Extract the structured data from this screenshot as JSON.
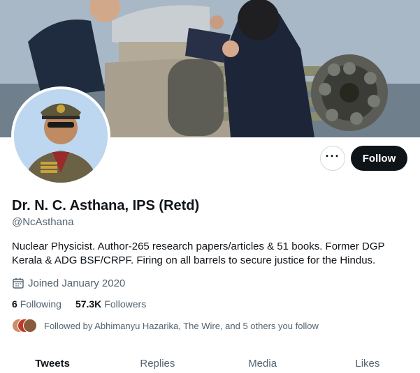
{
  "profile": {
    "name": "Dr. N. C. Asthana, IPS (Retd)",
    "handle": "@NcAsthana",
    "bio": "Nuclear Physicist. Author-265 research papers/articles & 51 books. Former DGP Kerala & ADG BSF/CRPF. Firing on all barrels to secure justice for the Hindus.",
    "joined": "Joined January 2020",
    "following_count": "6",
    "following_label": "Following",
    "followers_count": "57.3K",
    "followers_label": "Followers",
    "followed_by": "Followed by Abhimanyu Hazarika, The Wire, and 5 others you follow"
  },
  "actions": {
    "more_label": "···",
    "follow_label": "Follow"
  },
  "tabs": [
    {
      "label": "Tweets",
      "active": true
    },
    {
      "label": "Replies",
      "active": false
    },
    {
      "label": "Media",
      "active": false
    },
    {
      "label": "Likes",
      "active": false
    }
  ],
  "colors": {
    "accent": "#0f1419",
    "muted": "#536471",
    "border": "#cfd9de"
  },
  "icons": {
    "calendar": "calendar-icon",
    "more": "more-icon"
  }
}
